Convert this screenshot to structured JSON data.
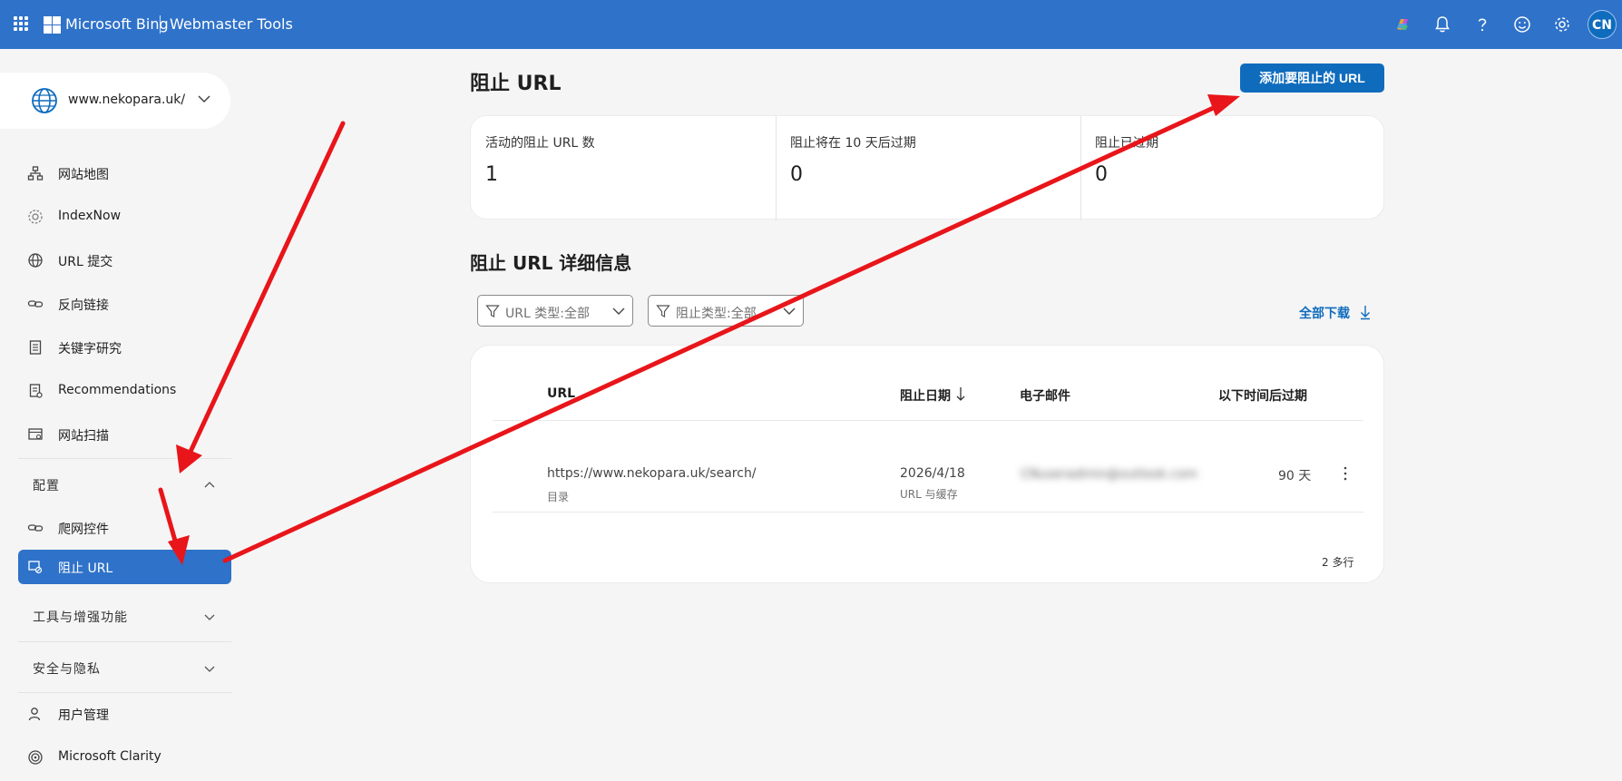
{
  "header": {
    "brand": "Microsoft Bing",
    "product": "Webmaster Tools",
    "avatar_initials": "CN",
    "icons": [
      "app-launcher-icon",
      "copilot-icon",
      "bell-icon",
      "help-icon",
      "smiley-icon",
      "gear-icon"
    ]
  },
  "sidebar": {
    "site": "www.nekopara.uk/",
    "items": [
      {
        "label": "网站地图",
        "icon": "sitemap-icon"
      },
      {
        "label": "IndexNow",
        "icon": "indexnow-icon"
      },
      {
        "label": "URL 提交",
        "icon": "globe-icon"
      },
      {
        "label": "反向链接",
        "icon": "link-icon"
      },
      {
        "label": "关键字研究",
        "icon": "document-icon"
      },
      {
        "label": "Recommendations",
        "icon": "recommendations-icon"
      },
      {
        "label": "网站扫描",
        "icon": "scan-icon"
      }
    ],
    "config_group": "配置",
    "config_items": [
      {
        "label": "爬网控件",
        "icon": "link-icon"
      },
      {
        "label": "阻止 URL",
        "icon": "block-url-icon"
      }
    ],
    "tools_group": "工具与增强功能",
    "privacy_group": "安全与隐私",
    "bottom_items": [
      {
        "label": "用户管理",
        "icon": "user-icon"
      },
      {
        "label": "Microsoft Clarity",
        "icon": "clarity-icon"
      }
    ]
  },
  "main": {
    "title": "阻止 URL",
    "add_button": "添加要阻止的 URL",
    "stats": [
      {
        "label": "活动的阻止 URL 数",
        "value": "1"
      },
      {
        "label": "阻止将在 10 天后过期",
        "value": "0"
      },
      {
        "label": "阻止已过期",
        "value": "0"
      }
    ],
    "details_title": "阻止 URL 详细信息",
    "filters": [
      {
        "label": "URL 类型:全部"
      },
      {
        "label": "阻止类型:全部"
      }
    ],
    "download_label": "全部下载",
    "table": {
      "columns": [
        "URL",
        "阻止日期",
        "电子邮件",
        "以下时间后过期"
      ],
      "rows": [
        {
          "url": "https://www.nekopara.uk/search/",
          "url_type": "目录",
          "date": "2026/4/18",
          "block_type": "URL 与缓存",
          "email": "CNuseradmin@outlook.com",
          "expires": "90 天"
        }
      ],
      "footer": "2 多行"
    }
  },
  "colors": {
    "header_bg": "#2f72c9",
    "accent": "#0f6cbd",
    "annotation_arrow": "#e8151a"
  }
}
